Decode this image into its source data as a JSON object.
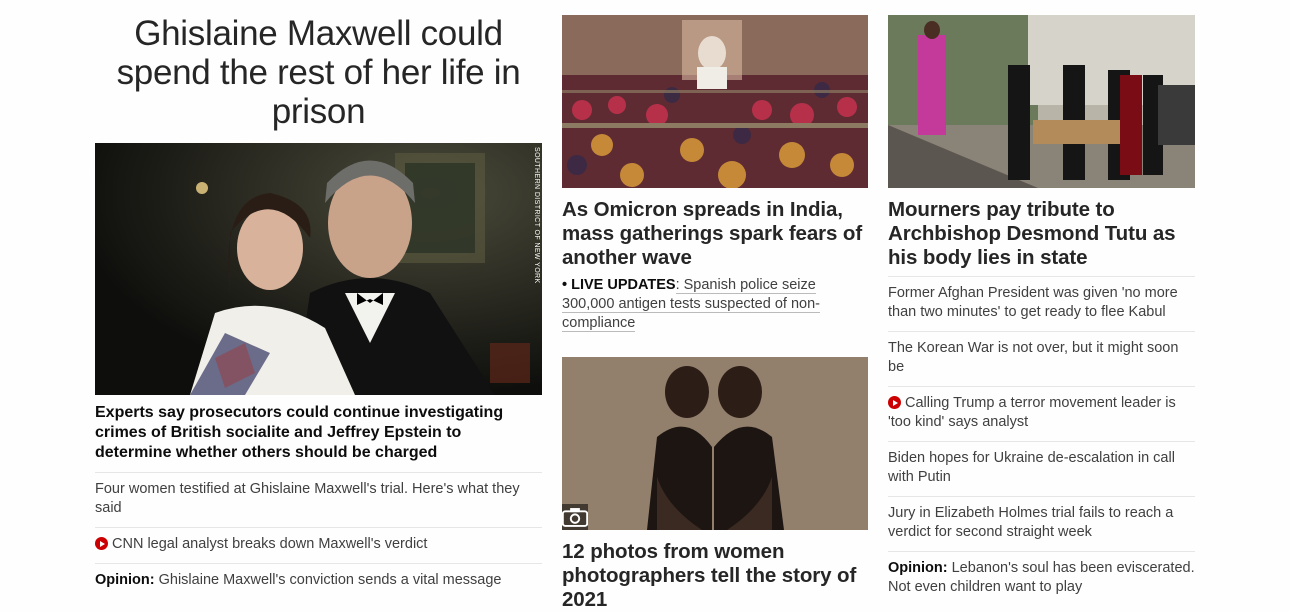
{
  "left": {
    "headline": "Ghislaine Maxwell could spend the rest of her life in prison",
    "image_credit": "SOUTHERN DISTRICT OF NEW YORK",
    "lead": "Experts say prosecutors could continue investigating crimes of British socialite and Jeffrey Epstein to determine whether others should be charged",
    "items": [
      {
        "text": "Four women testified at Ghislaine Maxwell's trial. Here's what they said"
      },
      {
        "text": "CNN legal analyst breaks down Maxwell's verdict",
        "video": true
      },
      {
        "prefix": "Opinion:",
        "text": " Ghislaine Maxwell's conviction sends a vital message"
      }
    ]
  },
  "middle": {
    "story1": {
      "headline": "As Omicron spreads in India, mass gatherings spark fears of another wave",
      "live_tag": "• LIVE UPDATES",
      "live_text": ": Spanish police seize 300,000 antigen tests suspected of non-compliance"
    },
    "story2": {
      "headline": "12 photos from women photographers tell the story of 2021",
      "icon": "camera-icon"
    }
  },
  "right": {
    "headline": "Mourners pay tribute to Archbishop Desmond Tutu as his body lies in state",
    "items": [
      {
        "text": "Former Afghan President was given 'no more than two minutes' to get ready to flee Kabul"
      },
      {
        "text": "The Korean War is not over, but it might soon be"
      },
      {
        "text": "Calling Trump a terror movement leader is 'too kind' says analyst",
        "video": true
      },
      {
        "text": "Biden hopes for Ukraine de-escalation in call with Putin"
      },
      {
        "text": "Jury in Elizabeth Holmes trial fails to reach a verdict for second straight week"
      },
      {
        "prefix": "Opinion:",
        "text": " Lebanon's soul has been eviscerated. Not even children want to play"
      }
    ]
  },
  "colors": {
    "video_red": "#cc0000",
    "text": "#0c0c0c",
    "muted": "#404040"
  }
}
